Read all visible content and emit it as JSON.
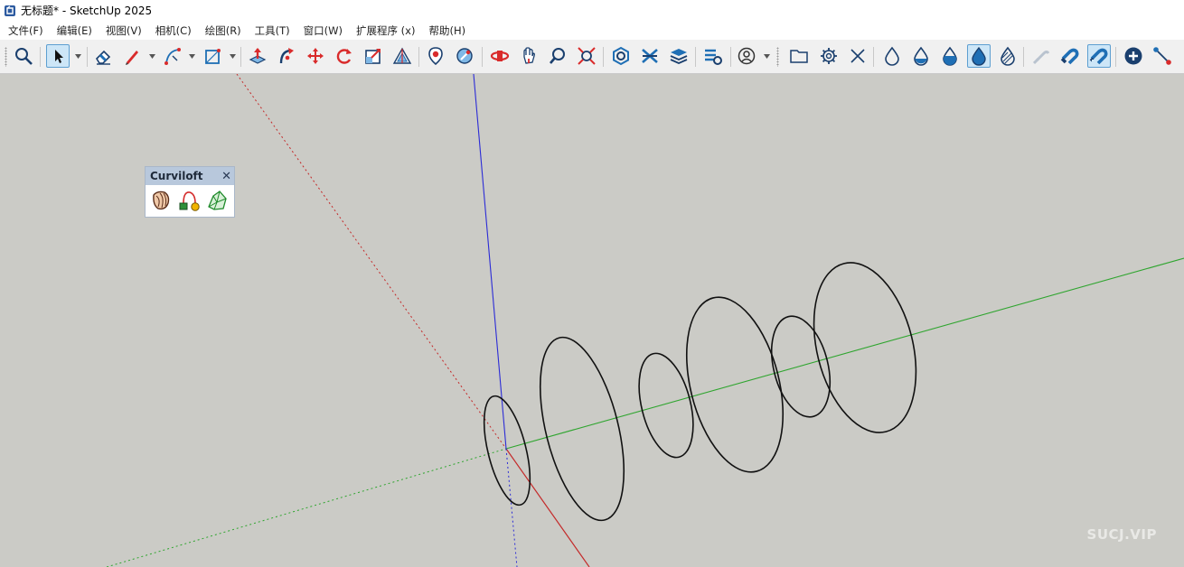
{
  "window": {
    "title": "无标题* - SketchUp 2025",
    "logo_icon": "sketchup-logo-icon"
  },
  "menubar": {
    "items": [
      "文件(F)",
      "编辑(E)",
      "视图(V)",
      "相机(C)",
      "绘图(R)",
      "工具(T)",
      "窗口(W)",
      "扩展程序 (x)",
      "帮助(H)"
    ]
  },
  "toolbar": {
    "tools": [
      "zoom-icon",
      "select-icon",
      "eraser-icon",
      "pencil-line-icon",
      "arc-icon",
      "rectangle-icon",
      "push-pull-icon",
      "follow-me-icon",
      "move-icon",
      "rotate-icon",
      "scale-icon",
      "offset-icon",
      "position-camera-icon",
      "walk-icon",
      "orbit-icon",
      "pan-icon",
      "zoom-window-icon",
      "zoom-extents-icon",
      "solid-tools-icon",
      "sandbox-icon",
      "layers-icon",
      "scenes-icon",
      "profile-icon",
      "folder-icon",
      "settings-icon",
      "close-icon",
      "xray-drop-icon",
      "half-drop-icon",
      "drop-icon",
      "drop-active-icon",
      "hatched-drop-icon",
      "magnet-off-icon",
      "magnet-icon",
      "magnet-active-icon",
      "add-icon",
      "connect-points-icon"
    ],
    "active": [
      "select-icon",
      "drop-active-icon",
      "magnet-active-icon"
    ]
  },
  "curviloft_panel": {
    "title": "Curviloft",
    "close_glyph": "✕",
    "tools": [
      "loft-by-spline-icon",
      "loft-along-path-icon",
      "skinning-icon"
    ]
  },
  "watermark": "SUCJ.VIP",
  "colors": {
    "viewport_bg": "#cbcbc6",
    "red_axis": "#c42a2a",
    "green_axis": "#2fa52f",
    "blue_axis": "#2b2bd6",
    "accent_blue": "#1f6fb5",
    "ring_stroke": "#111111"
  }
}
